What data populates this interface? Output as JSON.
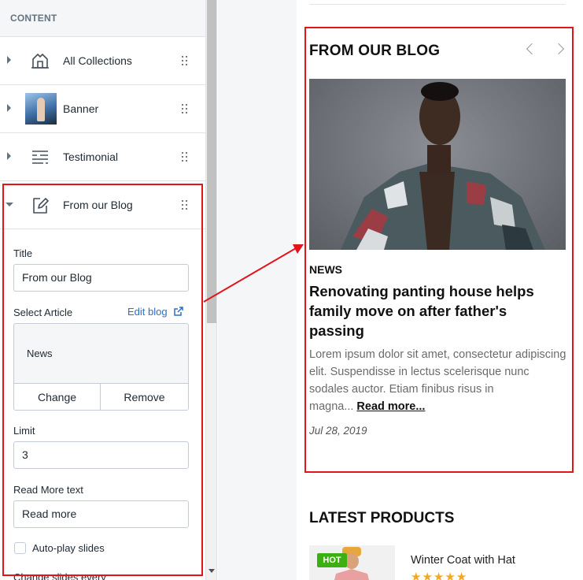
{
  "sidebar": {
    "header": "CONTENT",
    "sections": [
      {
        "label": "All Collections",
        "icon": "collections-icon"
      },
      {
        "label": "Banner",
        "icon": "banner-thumbnail"
      },
      {
        "label": "Testimonial",
        "icon": "testimonial-icon"
      },
      {
        "label": "From our Blog",
        "icon": "edit-blog-icon"
      }
    ],
    "settings": {
      "title_label": "Title",
      "title_value": "From our Blog",
      "select_article_label": "Select Article",
      "edit_blog_label": "Edit blog",
      "article_name": "News",
      "change_label": "Change",
      "remove_label": "Remove",
      "limit_label": "Limit",
      "limit_value": "3",
      "read_more_label": "Read More text",
      "read_more_value": "Read more",
      "autoplay_label": "Auto-play slides",
      "change_slides_label": "Change slides every"
    }
  },
  "preview": {
    "blog_title": "FROM OUR BLOG",
    "category": "NEWS",
    "headline": "Renovating panting house helps family move on after father's passing",
    "excerpt": "Lorem ipsum dolor sit amet, consectetur adipiscing elit. Suspendisse in lectus scelerisque nunc sodales auctor. Etiam finibus risus in magna...",
    "read_more": "Read more...",
    "date": "Jul 28, 2019",
    "latest_title": "LATEST PRODUCTS",
    "product_badge": "HOT",
    "product_name": "Winter Coat with Hat",
    "product_stars": "★★★★★"
  },
  "colors": {
    "annotation_red": "#e4141b",
    "link_blue": "#2c6ecb",
    "badge_green": "#3bb010",
    "star_orange": "#f5a623"
  }
}
